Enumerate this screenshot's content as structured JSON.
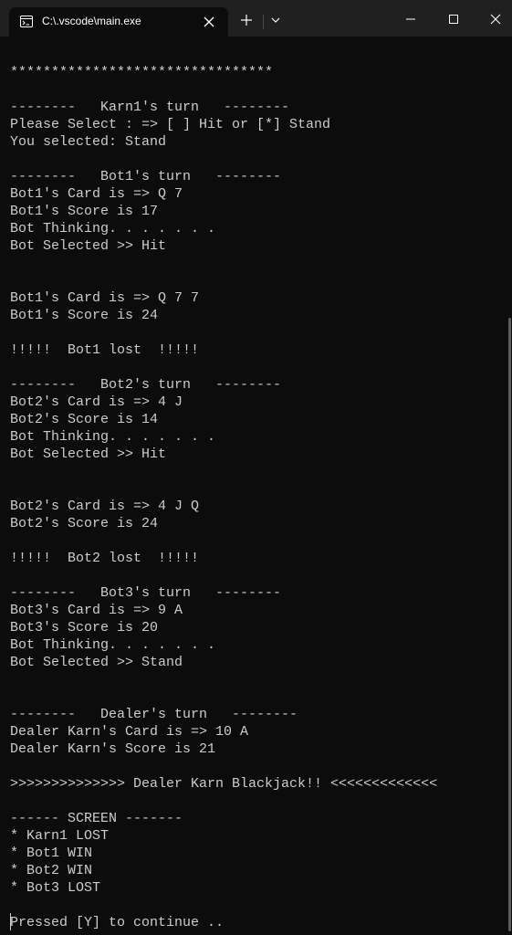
{
  "window": {
    "tab_title": "C:\\.vscode\\main.exe"
  },
  "colors": {
    "terminal_bg": "#0c0c0c",
    "titlebar_bg": "#202020",
    "text": "#cccccc"
  },
  "icons": {
    "tab": "console-app-icon",
    "close_tab": "close-icon",
    "new_tab": "plus-icon",
    "dropdown": "chevron-down-icon",
    "minimize": "minimize-icon",
    "maximize": "maximize-icon",
    "close_window": "close-icon"
  },
  "console": {
    "lines": [
      "********************************",
      "",
      "--------   Karn1's turn   --------",
      "Please Select : => [ ] Hit or [*] Stand",
      "You selected: Stand",
      "",
      "--------   Bot1's turn   --------",
      "Bot1's Card is => Q 7",
      "Bot1's Score is 17",
      "Bot Thinking. . . . . . .",
      "Bot Selected >> Hit",
      "",
      "",
      "Bot1's Card is => Q 7 7",
      "Bot1's Score is 24",
      "",
      "!!!!!  Bot1 lost  !!!!!",
      "",
      "--------   Bot2's turn   --------",
      "Bot2's Card is => 4 J",
      "Bot2's Score is 14",
      "Bot Thinking. . . . . . .",
      "Bot Selected >> Hit",
      "",
      "",
      "Bot2's Card is => 4 J Q",
      "Bot2's Score is 24",
      "",
      "!!!!!  Bot2 lost  !!!!!",
      "",
      "--------   Bot3's turn   --------",
      "Bot3's Card is => 9 A",
      "Bot3's Score is 20",
      "Bot Thinking. . . . . . .",
      "Bot Selected >> Stand",
      "",
      "",
      "--------   Dealer's turn   --------",
      "Dealer Karn's Card is => 10 A",
      "Dealer Karn's Score is 21",
      "",
      ">>>>>>>>>>>>>> Dealer Karn Blackjack!! <<<<<<<<<<<<<",
      "",
      "------ SCREEN -------",
      "* Karn1 LOST",
      "* Bot1 WIN",
      "* Bot2 WIN",
      "* Bot3 LOST",
      "",
      "Pressed [Y] to continue .."
    ]
  }
}
